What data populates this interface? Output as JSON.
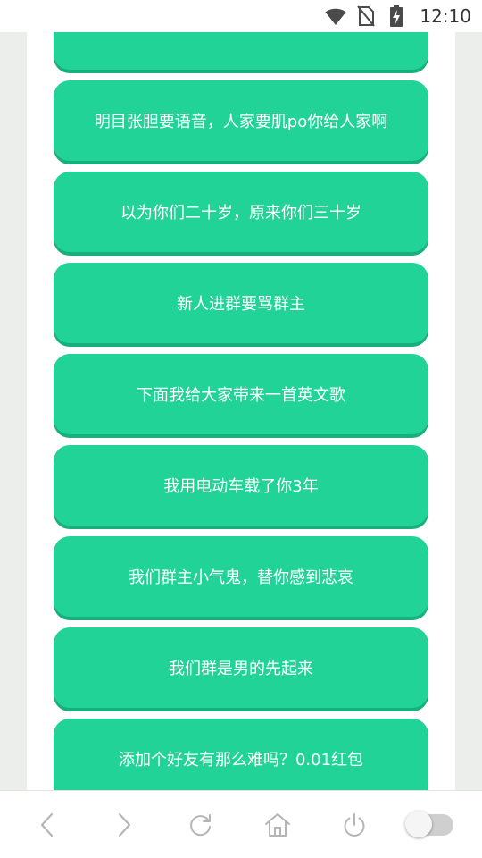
{
  "status_bar": {
    "time": "12:10",
    "icons": [
      "wifi-icon",
      "no-sim-icon",
      "battery-charging-icon"
    ]
  },
  "buttons": [
    {
      "label": ""
    },
    {
      "label": "明目张胆要语音，人家要肌po你给人家啊"
    },
    {
      "label": "以为你们二十岁，原来你们三十岁"
    },
    {
      "label": "新人进群要骂群主"
    },
    {
      "label": "下面我给大家带来一首英文歌"
    },
    {
      "label": "我用电动车载了你3年"
    },
    {
      "label": "我们群主小气鬼，替你感到悲哀"
    },
    {
      "label": "我们群是男的先起来"
    },
    {
      "label": "添加个好友有那么难吗？0.01红包"
    }
  ],
  "bottom_nav": {
    "items": [
      "back-icon",
      "forward-icon",
      "refresh-icon",
      "home-icon",
      "power-icon",
      "toggle-switch"
    ],
    "toggle_state": "off"
  },
  "colors": {
    "button_bg": "#22d398",
    "button_shadow": "#17b07c",
    "page_bg": "#eceeec",
    "icon": "#b5b5b5"
  }
}
